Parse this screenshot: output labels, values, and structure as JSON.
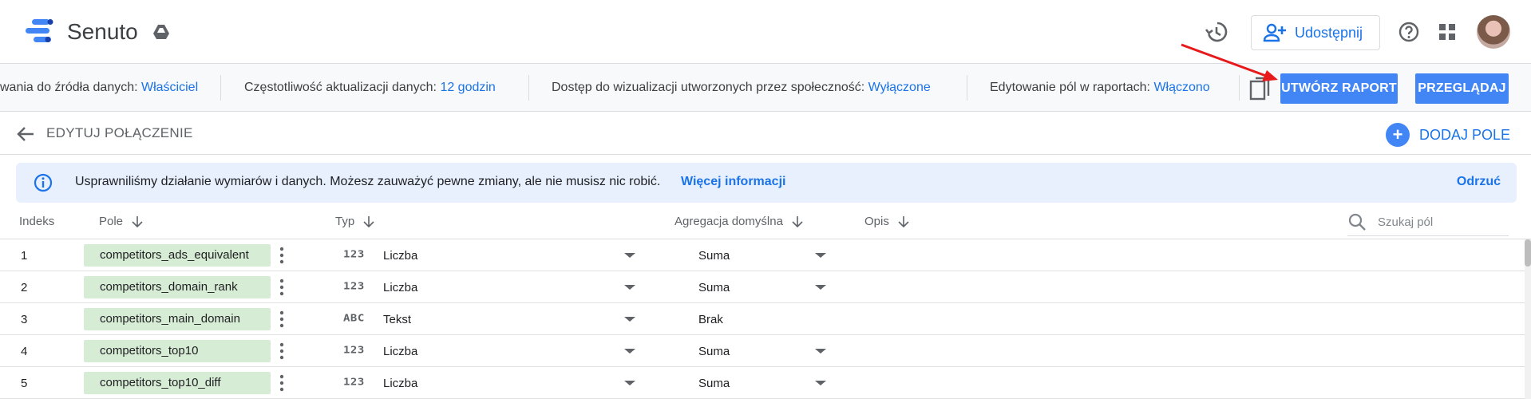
{
  "header": {
    "app_title": "Senuto",
    "share_label": "Udostępnij"
  },
  "infobar": {
    "items": [
      {
        "label": "wania do źródła danych: ",
        "value": "Właściciel"
      },
      {
        "label": "Częstotliwość aktualizacji danych: ",
        "value": "12 godzin"
      },
      {
        "label": "Dostęp do wizualizacji utworzonych przez społeczność: ",
        "value": "Wyłączone"
      },
      {
        "label": "Edytowanie pól w raportach: ",
        "value": "Włączono"
      }
    ],
    "create_report": "UTWÓRZ RAPORT",
    "browse": "PRZEGLĄDAJ"
  },
  "editbar": {
    "title": "EDYTUJ POŁĄCZENIE",
    "add_field": "DODAJ POLE"
  },
  "banner": {
    "message": "Usprawniliśmy działanie wymiarów i danych. Możesz zauważyć pewne zmiany, ale nie musisz nic robić.",
    "more": "Więcej informacji",
    "dismiss": "Odrzuć"
  },
  "table": {
    "headers": {
      "index": "Indeks",
      "field": "Pole",
      "type": "Typ",
      "aggregation": "Agregacja domyślna",
      "description": "Opis"
    },
    "search_placeholder": "Szukaj pól",
    "rows": [
      {
        "index": "1",
        "field": "competitors_ads_equivalent",
        "type_icon": "123",
        "type": "Liczba",
        "aggregation": "Suma",
        "agg_dropdown": true
      },
      {
        "index": "2",
        "field": "competitors_domain_rank",
        "type_icon": "123",
        "type": "Liczba",
        "aggregation": "Suma",
        "agg_dropdown": true
      },
      {
        "index": "3",
        "field": "competitors_main_domain",
        "type_icon": "ABC",
        "type": "Tekst",
        "aggregation": "Brak",
        "agg_dropdown": false
      },
      {
        "index": "4",
        "field": "competitors_top10",
        "type_icon": "123",
        "type": "Liczba",
        "aggregation": "Suma",
        "agg_dropdown": true
      },
      {
        "index": "5",
        "field": "competitors_top10_diff",
        "type_icon": "123",
        "type": "Liczba",
        "aggregation": "Suma",
        "agg_dropdown": true
      }
    ]
  },
  "colors": {
    "accent": "#1a73e8",
    "primary_button": "#4285f4",
    "field_chip": "#d7ecd4",
    "banner_bg": "#e8f0fe",
    "annotation_arrow": "#e8191a"
  }
}
